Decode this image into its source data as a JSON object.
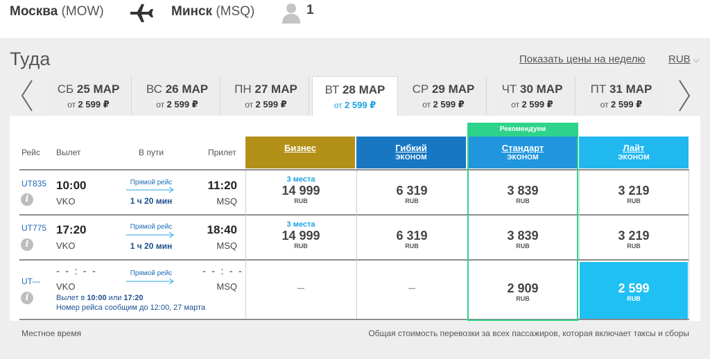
{
  "header": {
    "from_city": "Москва",
    "from_code": "(MOW)",
    "to_city": "Минск",
    "to_code": "(MSQ)",
    "passengers": "1",
    "plane_icon": "airplane-icon",
    "pax_icon": "person-icon"
  },
  "toolbar": {
    "direction": "Туда",
    "week_link": "Показать цены на неделю",
    "currency": "RUB",
    "currency_chevron": "chevron-down-icon"
  },
  "dates": [
    {
      "weekday": "СБ",
      "date": "25 МАР",
      "price_prefix": "от",
      "price": "2 599 ₽",
      "active": false
    },
    {
      "weekday": "ВС",
      "date": "26 МАР",
      "price_prefix": "от",
      "price": "2 599 ₽",
      "active": false
    },
    {
      "weekday": "ПН",
      "date": "27 МАР",
      "price_prefix": "от",
      "price": "2 599 ₽",
      "active": false
    },
    {
      "weekday": "ВТ",
      "date": "28 МАР",
      "price_prefix": "от",
      "price": "2 599 ₽",
      "active": true
    },
    {
      "weekday": "СР",
      "date": "29 МАР",
      "price_prefix": "от",
      "price": "2 599 ₽",
      "active": false
    },
    {
      "weekday": "ЧТ",
      "date": "30 МАР",
      "price_prefix": "от",
      "price": "2 599 ₽",
      "active": false
    },
    {
      "weekday": "ПТ",
      "date": "31 МАР",
      "price_prefix": "от",
      "price": "2 599 ₽",
      "active": false
    }
  ],
  "columns": {
    "flight": "Рейс",
    "departure": "Вылет",
    "in_transit": "В пути",
    "arrival": "Прилет"
  },
  "recommend": "Рекомендуем",
  "fares": [
    {
      "name": "Бизнес",
      "sub": "",
      "color": "#b39118"
    },
    {
      "name": "Гибкий",
      "sub": "ЭКОНОМ",
      "color": "#1877c3"
    },
    {
      "name": "Стандарт",
      "sub": "ЭКОНОМ",
      "color": "#2196df"
    },
    {
      "name": "Лайт",
      "sub": "ЭКОНОМ",
      "color": "#21b8f0"
    }
  ],
  "flights": [
    {
      "number": "UT835",
      "dep_time": "10:00",
      "dep_airport": "VKO",
      "direct": "Прямой рейс",
      "duration": "1 ч 20 мин",
      "arr_time": "11:20",
      "arr_airport": "MSQ",
      "prices": [
        {
          "seats": "3 места",
          "amount": "14 999",
          "cur": "RUB"
        },
        {
          "seats": "",
          "amount": "6 319",
          "cur": "RUB"
        },
        {
          "seats": "",
          "amount": "3 839",
          "cur": "RUB"
        },
        {
          "seats": "",
          "amount": "3 219",
          "cur": "RUB"
        }
      ]
    },
    {
      "number": "UT775",
      "dep_time": "17:20",
      "dep_airport": "VKO",
      "direct": "Прямой рейс",
      "duration": "1 ч 20 мин",
      "arr_time": "18:40",
      "arr_airport": "MSQ",
      "prices": [
        {
          "seats": "3 места",
          "amount": "14 999",
          "cur": "RUB"
        },
        {
          "seats": "",
          "amount": "6 319",
          "cur": "RUB"
        },
        {
          "seats": "",
          "amount": "3 839",
          "cur": "RUB"
        },
        {
          "seats": "",
          "amount": "3 219",
          "cur": "RUB"
        }
      ]
    },
    {
      "number": "UT---",
      "dep_time": "- - : - -",
      "dep_airport": "VKO",
      "direct": "Прямой рейс",
      "duration": "",
      "arr_time": "- - : - -",
      "arr_airport": "MSQ",
      "note_prefix": "Вылет в",
      "note_time1": "10:00",
      "note_or": "или",
      "note_time2": "17:20",
      "note_line2": "Номер рейса сообщим до 12:00, 27 марта",
      "prices": [
        {
          "seats": "",
          "amount": "–",
          "cur": ""
        },
        {
          "seats": "",
          "amount": "–",
          "cur": ""
        },
        {
          "seats": "",
          "amount": "2 909",
          "cur": "RUB"
        },
        {
          "seats": "",
          "amount": "2 599",
          "cur": "RUB"
        }
      ]
    }
  ],
  "footer": {
    "left": "Местное время",
    "right": "Общая стоимость перевозки за всех пассажиров, которая включает таксы и сборы"
  }
}
